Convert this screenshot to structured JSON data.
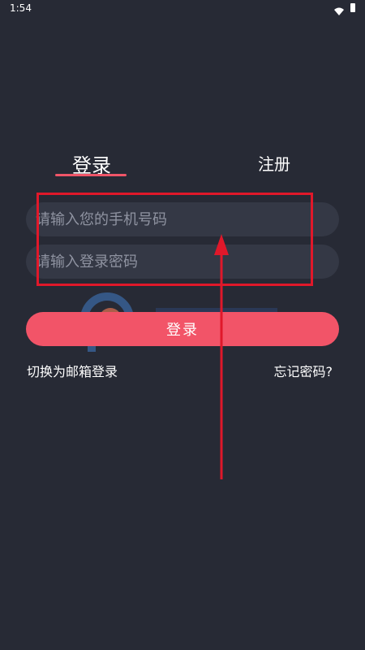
{
  "status_bar": {
    "time": "1:54"
  },
  "tabs": [
    {
      "label": "登录",
      "active": true
    },
    {
      "label": "注册",
      "active": false
    }
  ],
  "form": {
    "phone_placeholder": "请输入您的手机号码",
    "password_placeholder": "请输入登录密码",
    "submit_label": "登录"
  },
  "links": {
    "switch_email": "切换为邮箱登录",
    "forgot_password": "忘记密码?"
  },
  "colors": {
    "background": "#272a35",
    "input_bg": "#343845",
    "accent": "#f25468",
    "annotation_red": "#e0182a"
  }
}
